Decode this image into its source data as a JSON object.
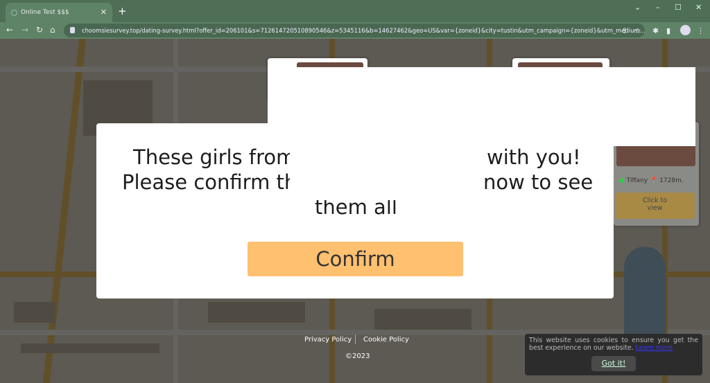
{
  "browser": {
    "tab_title": "Online Test $$$",
    "url": "choomsiesurvey.top/dating-survey.html?offer_id=206101&s=712614720510890546&z=5345116&b=14627462&geo=US&var={zoneid}&city=tustin&utm_campaign={zoneid}&utm_medium..."
  },
  "modal": {
    "line1_left": "These girls from",
    "line1_right": "with you!",
    "line2_left": "Please confirm th",
    "line2_right": "now to see",
    "line3": "them all",
    "confirm_label": "Confirm"
  },
  "profile_card": {
    "name": "Tiffany",
    "distance": "1728m.",
    "button": "Click to view",
    "online_color": "#2ecc40"
  },
  "footer": {
    "privacy": "Privacy Policy",
    "cookie": "Cookie Policy",
    "copyright": "©2023"
  },
  "cookie_banner": {
    "text": "This website uses cookies to ensure you get the best experience on our website.",
    "link": "Learn more",
    "button": "Got it!"
  },
  "colors": {
    "confirm": "#ffc06f",
    "browser_frame": "#5f8367"
  }
}
